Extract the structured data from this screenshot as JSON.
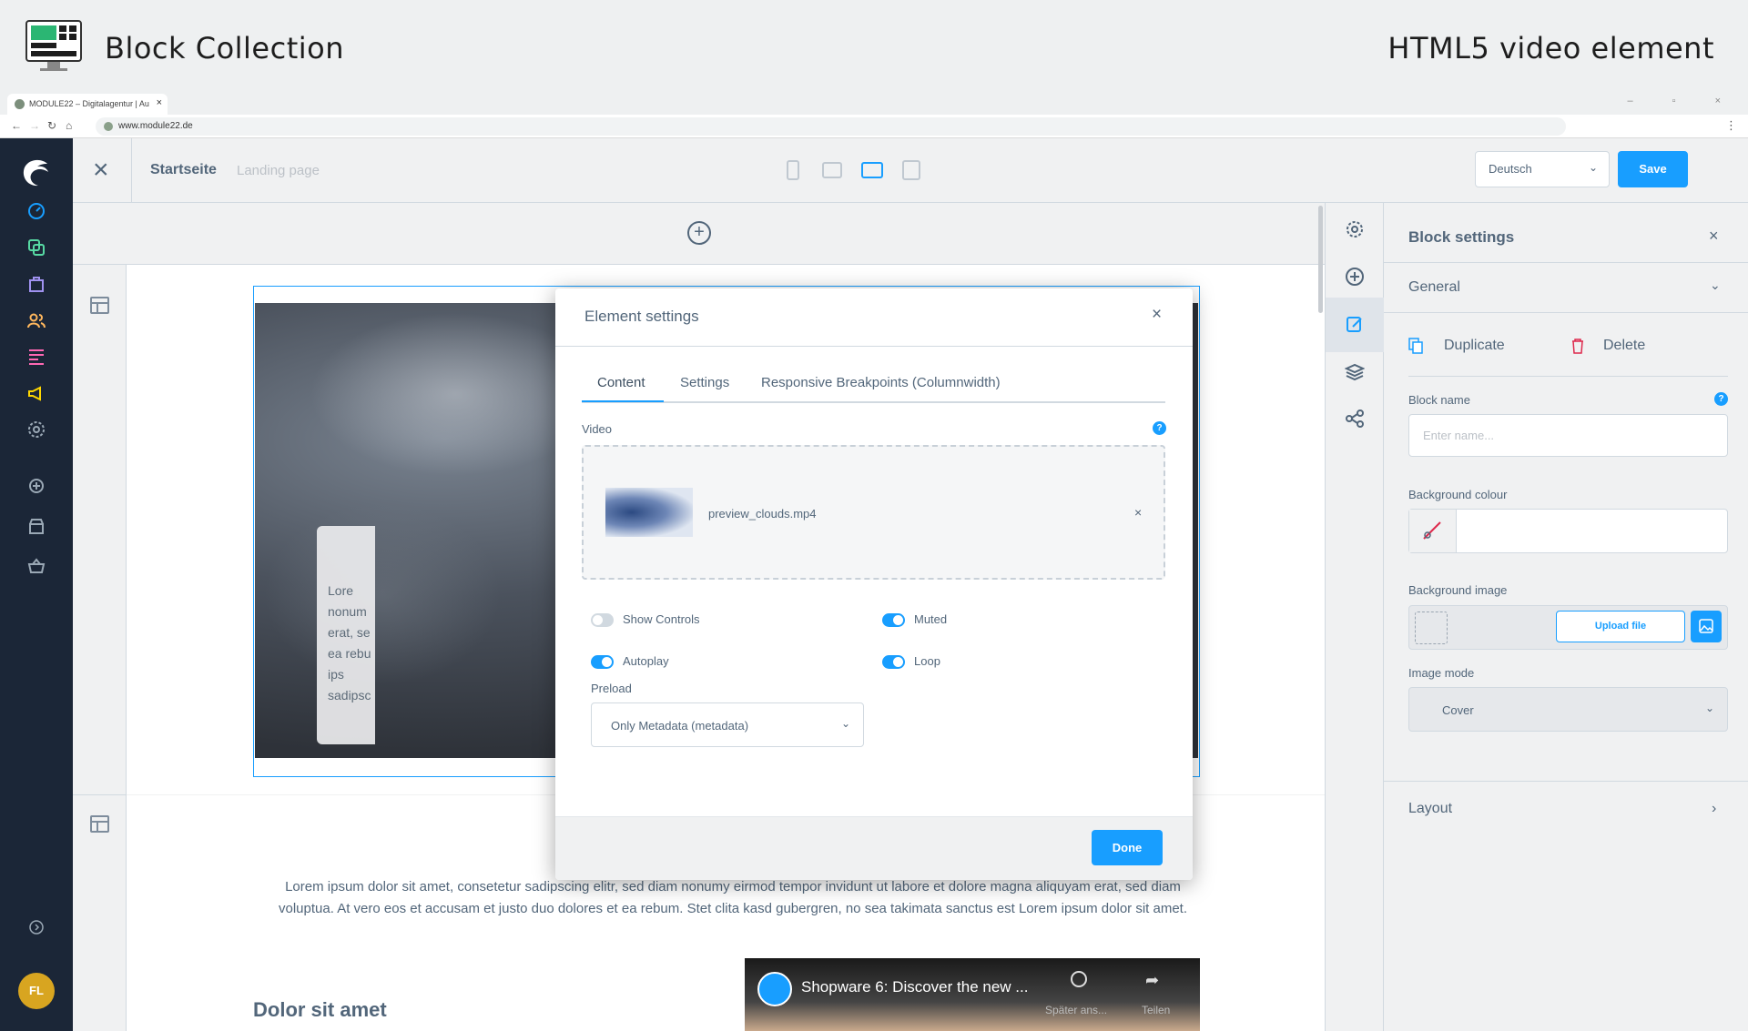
{
  "banner": {
    "title": "Block Collection",
    "subtitle": "HTML5 video element",
    "icon": "monitor-icon"
  },
  "browser": {
    "tab_title": "MODULE22 – Digitalagentur | Au",
    "tab_close": "×",
    "window_controls": "–  ▫  ×",
    "url": "www.module22.de"
  },
  "admin_sidebar": {
    "icons": [
      "dashboard-icon",
      "catalog-icon",
      "orders-icon",
      "customers-icon",
      "content-icon",
      "marketing-icon",
      "settings-icon",
      "add-icon",
      "store-icon",
      "basket-icon",
      "help-icon"
    ],
    "accent_colors": [
      "#189eff",
      "#57d9a3",
      "#a092f0",
      "#ffb75d",
      "#ff68b4",
      "#ffd700",
      "#9aa8b5"
    ],
    "avatar_initials": "FL"
  },
  "toolbar": {
    "close_icon": "×",
    "page_title": "Startseite",
    "page_type": "Landing page",
    "devices": [
      "mobile-icon",
      "tablet-icon",
      "desktop-icon",
      "form-view-icon"
    ],
    "language": "Deutsch",
    "save_label": "Save"
  },
  "canvas": {
    "add_symbol": "+",
    "overlay_text_lines": [
      "Lore",
      "nonum",
      "erat, se",
      "ea rebu",
      "ips",
      "sadipsc"
    ],
    "paragraph": "Lorem ipsum dolor sit amet, consetetur sadipscing elitr, sed diam nonumy eirmod tempor invidunt ut labore et dolore magna aliquyam erat, sed diam voluptua. At vero eos et accusam et justo duo dolores et ea rebum. Stet clita kasd gubergren, no sea takimata sanctus est Lorem ipsum dolor sit amet.",
    "heading": "Dolor sit amet",
    "youtube": {
      "title": "Shopware 6: Discover the new ...",
      "later_label": "Später ans...",
      "share_label": "Teilen"
    }
  },
  "block_settings": {
    "title": "Block settings",
    "close": "×",
    "general_label": "General",
    "duplicate_label": "Duplicate",
    "delete_label": "Delete",
    "block_name_label": "Block name",
    "block_name_placeholder": "Enter name...",
    "help": "?",
    "bg_colour_label": "Background colour",
    "bg_image_label": "Background image",
    "upload_label": "Upload file",
    "image_mode_label": "Image mode",
    "image_mode_value": "Cover",
    "layout_label": "Layout"
  },
  "modal": {
    "title": "Element settings",
    "close": "×",
    "tabs": [
      "Content",
      "Settings",
      "Responsive Breakpoints (Columnwidth)"
    ],
    "active_tab": "Content",
    "video_label": "Video",
    "help": "?",
    "video_file": "preview_clouds.mp4",
    "remove": "×",
    "toggles": {
      "show_controls": {
        "label": "Show Controls",
        "on": false
      },
      "muted": {
        "label": "Muted",
        "on": true
      },
      "autoplay": {
        "label": "Autoplay",
        "on": true
      },
      "loop": {
        "label": "Loop",
        "on": true
      }
    },
    "preload_label": "Preload",
    "preload_value": "Only Metadata (metadata)",
    "done_label": "Done"
  }
}
